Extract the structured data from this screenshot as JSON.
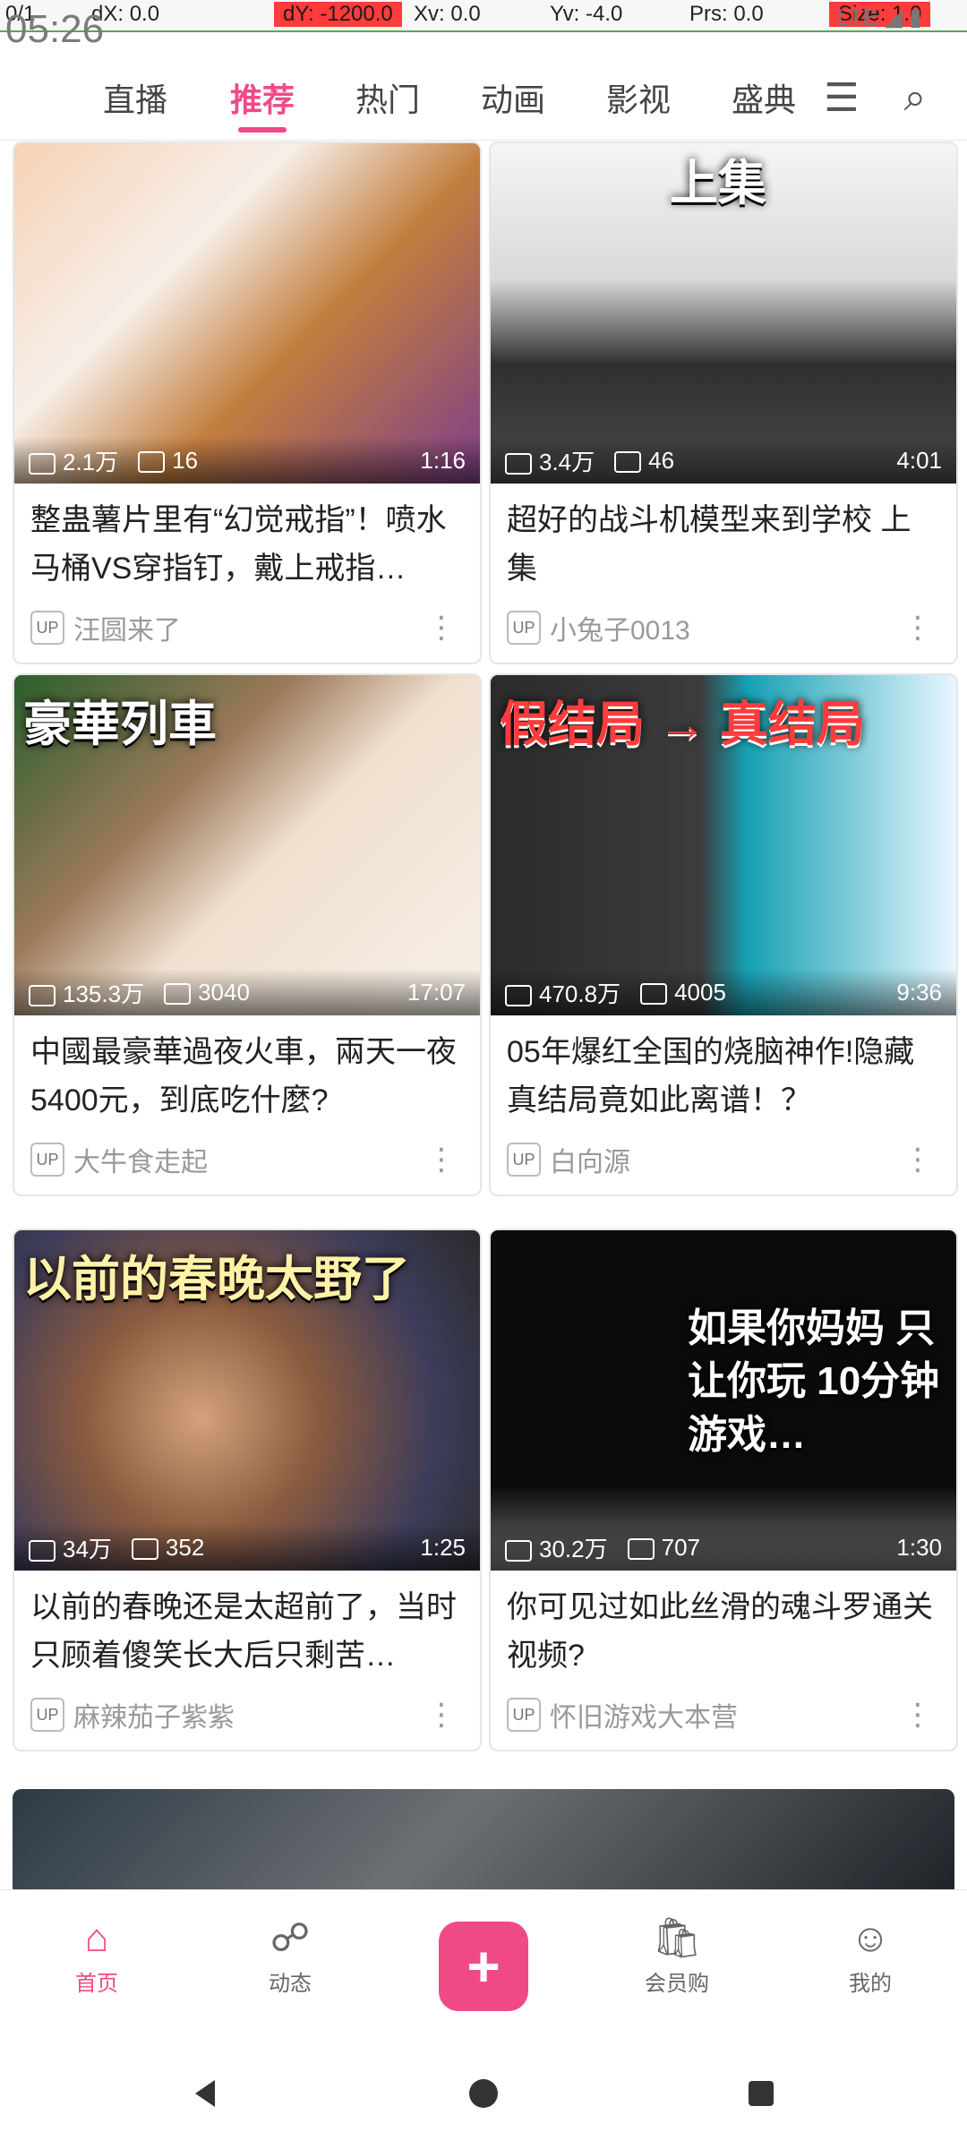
{
  "debug": {
    "pointer": "0/1",
    "dx": "dX: 0.0",
    "dy": "dY: -1200.0",
    "xv": "Xv: 0.0",
    "yv": "Yv: -4.0",
    "prs": "Prs: 0.0",
    "size": "Size: 1.0",
    "time": "05:26",
    "mini_icons": "LTE ◢ ▮"
  },
  "tabs": [
    {
      "label": "直播"
    },
    {
      "label": "推荐",
      "active": true
    },
    {
      "label": "热门"
    },
    {
      "label": "动画"
    },
    {
      "label": "影视"
    },
    {
      "label": "盛典"
    }
  ],
  "top_icons": {
    "menu": "menu-icon",
    "search": "search-icon"
  },
  "feed": [
    {
      "thumb_caption": "",
      "views": "2.1万",
      "danmaku": "16",
      "duration": "1:16",
      "title": "整蛊薯片里有“幻觉戒指”！喷水马桶VS穿指钉，戴上戒指…",
      "author": "汪圆来了"
    },
    {
      "thumb_caption": "上集",
      "views": "3.4万",
      "danmaku": "46",
      "duration": "4:01",
      "title": "超好的战斗机模型来到学校 上集",
      "author": "小兔子0013"
    },
    {
      "thumb_caption": "豪華列車",
      "views": "135.3万",
      "danmaku": "3040",
      "duration": "17:07",
      "title": "中國最豪華過夜火車，兩天一夜5400元，到底吃什麼?",
      "author": "大牛食走起"
    },
    {
      "thumb_caption": "假结局 → 真结局",
      "views": "470.8万",
      "danmaku": "4005",
      "duration": "9:36",
      "title": "05年爆红全国的烧脑神作!隐藏真结局竟如此离谱！？",
      "author": "白向源"
    },
    {
      "thumb_caption": "以前的春晚太野了",
      "views": "34万",
      "danmaku": "352",
      "duration": "1:25",
      "title": "以前的春晚还是太超前了，当时只顾着傻笑长大后只剩苦…",
      "author": "麻辣茄子紫紫"
    },
    {
      "thumb_caption": "如果你妈妈 只让你玩 10分钟游戏…",
      "views": "30.2万",
      "danmaku": "707",
      "duration": "1:30",
      "title": "你可见过如此丝滑的魂斗罗通关视频?",
      "author": "怀旧游戏大本营"
    }
  ],
  "bottom_nav": [
    {
      "label": "首页",
      "icon": "home-icon",
      "active": true
    },
    {
      "label": "动态",
      "icon": "activity-icon"
    },
    {
      "label": "",
      "icon": "publish-icon"
    },
    {
      "label": "会员购",
      "icon": "shop-icon"
    },
    {
      "label": "我的",
      "icon": "profile-icon"
    }
  ],
  "system_nav": {
    "back": "back-icon",
    "home": "home-circle-icon",
    "recents": "recents-icon"
  }
}
